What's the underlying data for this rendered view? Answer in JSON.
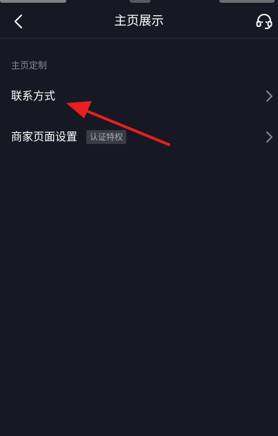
{
  "nav": {
    "title": "主页展示",
    "back_icon": "chevron-left-icon",
    "support_icon": "headset-icon"
  },
  "section": {
    "header": "主页定制"
  },
  "menu": {
    "contact": {
      "label": "联系方式",
      "icon": "chevron-right-icon"
    },
    "merchant": {
      "label": "商家页面设置",
      "badge": "认证特权",
      "icon": "chevron-right-icon"
    }
  },
  "colors": {
    "background": "#161823",
    "text_primary": "#ffffff",
    "text_secondary": "#8a8b91",
    "badge_bg": "#393b45",
    "annotation_arrow": "#e8201e"
  }
}
